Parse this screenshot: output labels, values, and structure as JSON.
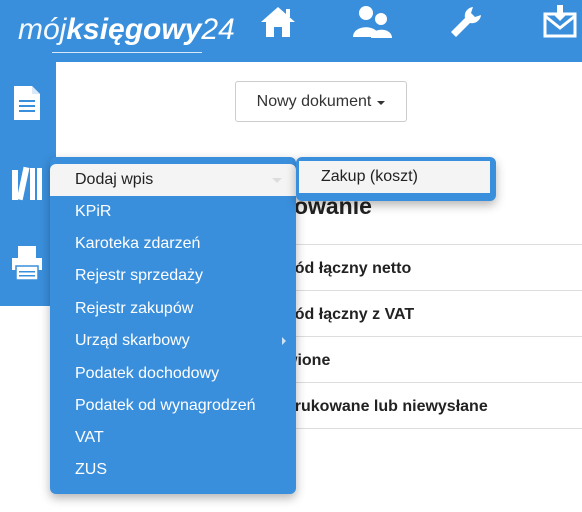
{
  "header": {
    "logo_part1": "mój",
    "logo_part2": "księgowy",
    "logo_part3": "24",
    "nav_icons": [
      "home-icon",
      "users-icon",
      "wrench-icon",
      "mail-download-icon"
    ]
  },
  "sidebar": {
    "icons": [
      "document-icon",
      "books-icon",
      "printer-icon"
    ]
  },
  "toolbar": {
    "new_document_label": "Nowy dokument"
  },
  "main": {
    "heading_fragment": "rowanie",
    "rows": [
      "hód łączny netto",
      "hód łączny z VAT",
      "wione",
      "drukowane lub niewysłane"
    ]
  },
  "menu": {
    "items": [
      {
        "label": "Dodaj wpis",
        "active": true
      },
      {
        "label": "KPiR"
      },
      {
        "label": "Karoteka zdarzeń"
      },
      {
        "label": "Rejestr sprzedaży"
      },
      {
        "label": "Rejestr zakupów"
      },
      {
        "label": "Urząd skarbowy",
        "has_submenu": true
      },
      {
        "label": "Podatek dochodowy"
      },
      {
        "label": "Podatek od wynagrodzeń"
      },
      {
        "label": "VAT"
      },
      {
        "label": "ZUS"
      }
    ]
  },
  "submenu": {
    "items": [
      {
        "label": "Zakup (koszt)"
      }
    ]
  },
  "colors": {
    "brand_blue": "#3a8fdc",
    "menu_hover_bg": "#f4f4f4"
  }
}
